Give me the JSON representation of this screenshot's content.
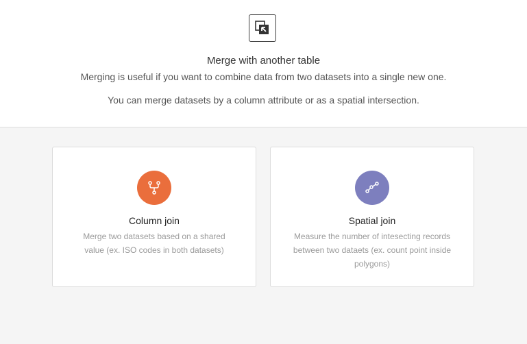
{
  "header": {
    "icon": "merge-icon",
    "title": "Merge with another table",
    "subtitle": "Merging is useful if you want to combine data from two datasets into a single new one.",
    "subtitle2": "You can merge datasets by a column attribute or as a spatial intersection."
  },
  "options": [
    {
      "title": "Column join",
      "description": "Merge two datasets based on a shared value (ex. ISO codes in both datasets)",
      "icon": "branch-icon",
      "color": "#ea6e3c"
    },
    {
      "title": "Spatial join",
      "description": "Measure the number of intesecting records between two dataets (ex. count point inside polygons)",
      "icon": "nodes-icon",
      "color": "#7d7fbe"
    }
  ],
  "colors": {
    "background": "#f5f5f5",
    "panel": "#ffffff"
  }
}
